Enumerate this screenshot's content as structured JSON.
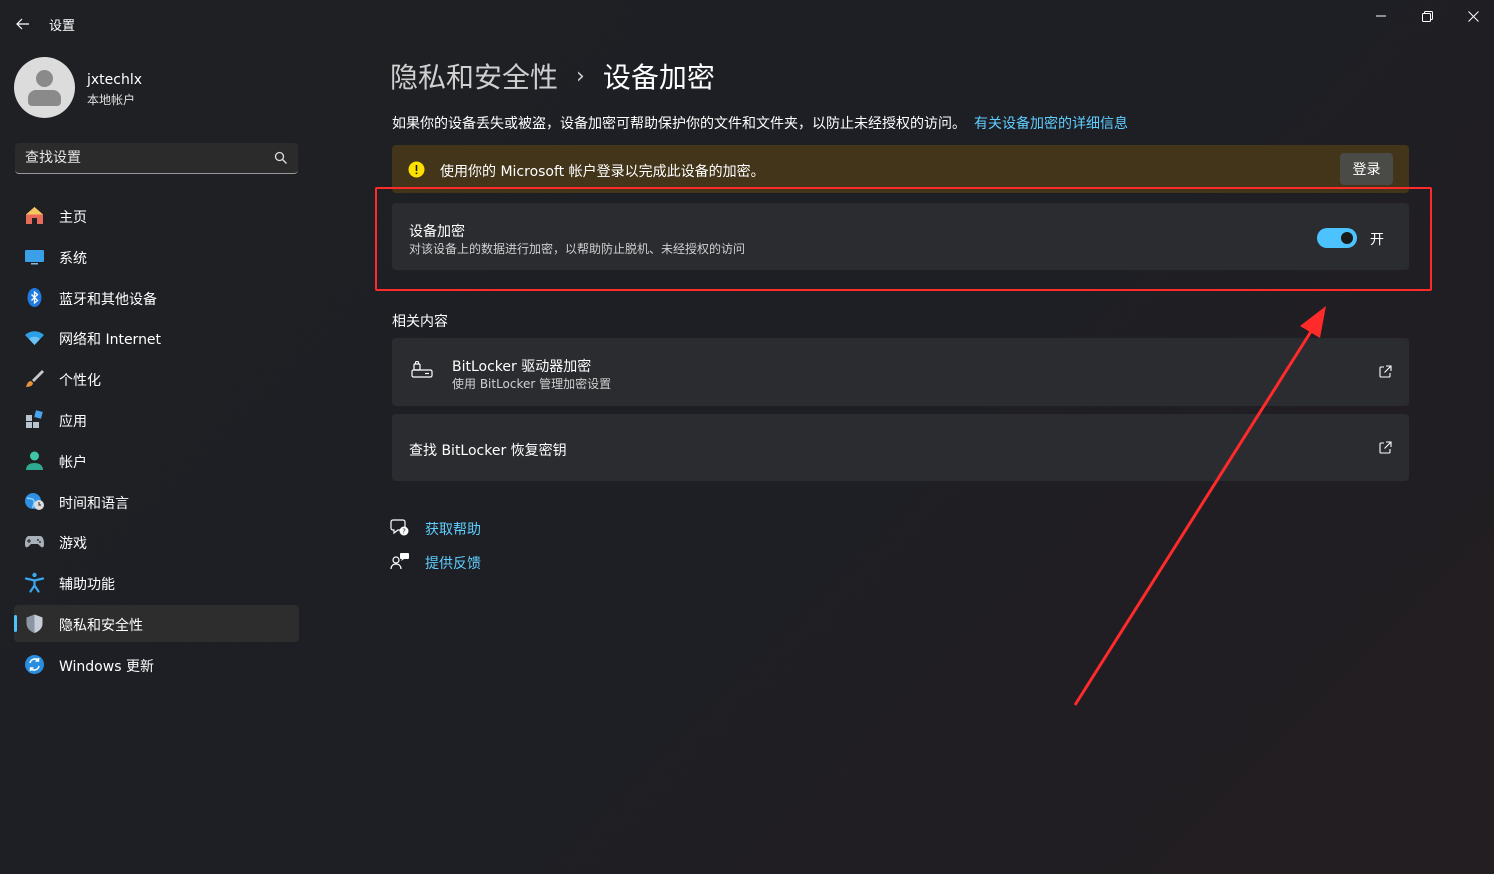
{
  "app": {
    "title": "设置"
  },
  "profile": {
    "name": "jxtechlx",
    "account_type": "本地帐户"
  },
  "search": {
    "placeholder": "查找设置"
  },
  "sidebar": {
    "items": [
      {
        "label": "主页",
        "icon": "home-icon"
      },
      {
        "label": "系统",
        "icon": "monitor-icon"
      },
      {
        "label": "蓝牙和其他设备",
        "icon": "bluetooth-icon"
      },
      {
        "label": "网络和 Internet",
        "icon": "wifi-icon"
      },
      {
        "label": "个性化",
        "icon": "brush-icon"
      },
      {
        "label": "应用",
        "icon": "apps-icon"
      },
      {
        "label": "帐户",
        "icon": "person-icon"
      },
      {
        "label": "时间和语言",
        "icon": "globe-clock-icon"
      },
      {
        "label": "游戏",
        "icon": "gamepad-icon"
      },
      {
        "label": "辅助功能",
        "icon": "accessibility-icon"
      },
      {
        "label": "隐私和安全性",
        "icon": "shield-icon",
        "active": true
      },
      {
        "label": "Windows 更新",
        "icon": "update-icon"
      }
    ]
  },
  "main": {
    "breadcrumb": {
      "parent": "隐私和安全性",
      "current": "设备加密"
    },
    "description": "如果你的设备丢失或被盗，设备加密可帮助保护你的文件和文件夹，以防止未经授权的访问。",
    "description_link": "有关设备加密的详细信息",
    "warning": {
      "text": "使用你的 Microsoft 帐户登录以完成此设备的加密。",
      "button": "登录"
    },
    "encryption": {
      "title": "设备加密",
      "subtitle": "对该设备上的数据进行加密，以帮助防止脱机、未经授权的访问",
      "toggle_label": "开",
      "enabled": true
    },
    "related": {
      "title": "相关内容",
      "items": [
        {
          "title": "BitLocker 驱动器加密",
          "subtitle": "使用 BitLocker 管理加密设置"
        },
        {
          "title": "查找 BitLocker 恢复密钥"
        }
      ]
    },
    "help": {
      "get_help": "获取帮助",
      "feedback": "提供反馈"
    }
  },
  "colors": {
    "accent": "#4cc2ff",
    "link": "#60cdff",
    "warning_bg": "#433519",
    "annotation": "#ff2a2a"
  }
}
